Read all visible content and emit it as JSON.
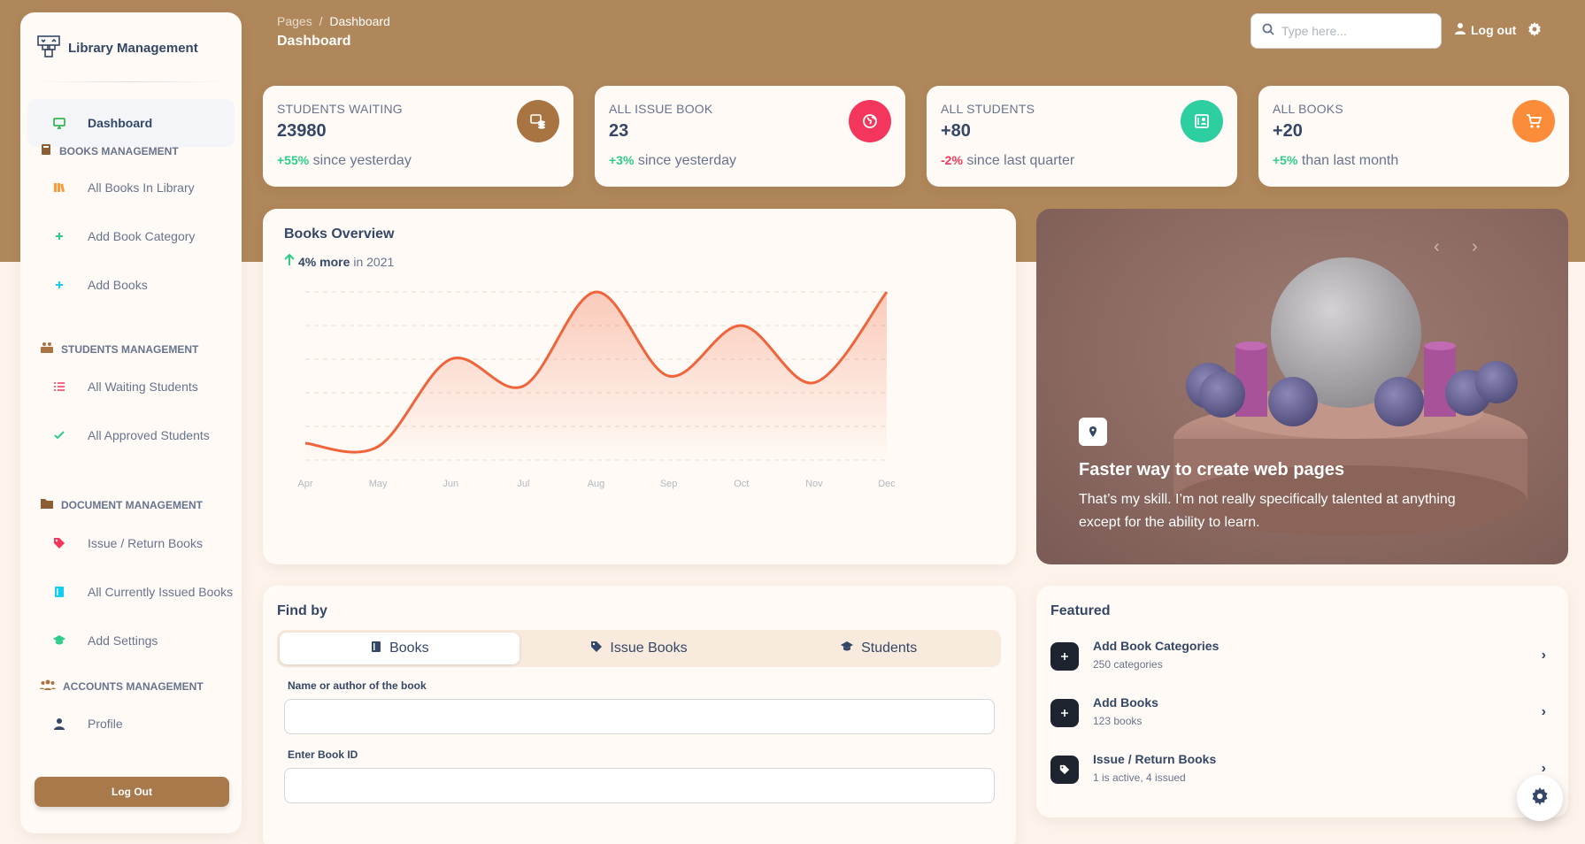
{
  "brand": {
    "name": "Library Management",
    "icon": "library-icon"
  },
  "sidebar": {
    "dashboard": {
      "label": "Dashboard",
      "icon": "monitor-icon"
    },
    "sections": [
      {
        "title": "Books Management",
        "icon": "book-icon",
        "items": [
          {
            "label": "All Books In Library",
            "icon": "books-icon"
          },
          {
            "label": "Add Book Category",
            "icon": "plus-icon"
          },
          {
            "label": "Add Books",
            "icon": "plus-icon"
          }
        ]
      },
      {
        "title": "Students Management",
        "icon": "students-icon",
        "items": [
          {
            "label": "All Waiting Students",
            "icon": "list-icon"
          },
          {
            "label": "All Approved Students",
            "icon": "check-icon"
          }
        ]
      },
      {
        "title": "Document Management",
        "icon": "folder-icon",
        "items": [
          {
            "label": "Issue / Return Books",
            "icon": "tag-icon"
          },
          {
            "label": "All Currently Issued Books",
            "icon": "book-open-icon"
          },
          {
            "label": "Add Settings",
            "icon": "graduation-cap-icon"
          }
        ]
      },
      {
        "title": "Accounts Management",
        "icon": "users-icon",
        "items": [
          {
            "label": "Profile",
            "icon": "user-icon"
          }
        ]
      }
    ],
    "logout_label": "Log Out"
  },
  "header": {
    "breadcrumb_parent": "Pages",
    "breadcrumb_separator": "/",
    "breadcrumb_current": "Dashboard",
    "title": "Dashboard",
    "search_placeholder": "Type here...",
    "logout_label": "Log out"
  },
  "stats": [
    {
      "title": "Students Waiting",
      "value": "23980",
      "pct": "+55%",
      "pct_color": "#2dce89",
      "foot": "since yesterday",
      "icon": "coins-icon",
      "icon_bg": "#a87442"
    },
    {
      "title": "All Issue Book",
      "value": "23",
      "pct": "+3%",
      "pct_color": "#2dce89",
      "foot": "since yesterday",
      "icon": "globe-icon",
      "icon_bg": "#f5365c"
    },
    {
      "title": "All Students",
      "value": "+80",
      "pct": "-2%",
      "pct_color": "#f5365c",
      "foot": "since last quarter",
      "icon": "id-card-icon",
      "icon_bg": "#2dcea0"
    },
    {
      "title": "All Books",
      "value": "+20",
      "pct": "+5%",
      "pct_color": "#2dce89",
      "foot": "than last month",
      "icon": "cart-icon",
      "icon_bg": "#fb8c3a"
    }
  ],
  "chart": {
    "title": "Books Overview",
    "sub_bold": "4% more",
    "sub_rest": "in 2021"
  },
  "chart_data": {
    "type": "line",
    "categories": [
      "Apr",
      "May",
      "Jun",
      "Jul",
      "Aug",
      "Sep",
      "Oct",
      "Nov",
      "Dec"
    ],
    "series": [
      {
        "values": [
          50,
          40,
          300,
          220,
          500,
          250,
          400,
          230,
          500
        ]
      }
    ],
    "ylim": [
      0,
      500
    ],
    "grid": true,
    "color": "#f0643c"
  },
  "hero": {
    "title": "Faster way to create web pages",
    "body": "That’s my skill. I’m not really specifically talented at anything except for the ability to learn.",
    "icon": "pin-icon"
  },
  "find": {
    "title": "Find by",
    "tabs": [
      {
        "label": "Books",
        "icon": "book-icon"
      },
      {
        "label": "Issue Books",
        "icon": "tag-icon"
      },
      {
        "label": "Students",
        "icon": "graduation-cap-icon"
      }
    ],
    "field1_label": "Name or author of the book",
    "field1_value": "",
    "field2_label": "Enter Book ID",
    "field2_value": ""
  },
  "featured": {
    "title": "Featured",
    "items": [
      {
        "name": "Add Book Categories",
        "desc": "250 categories",
        "icon": "plus-icon"
      },
      {
        "name": "Add Books",
        "desc": "123 books",
        "icon": "plus-icon"
      },
      {
        "name": "Issue / Return Books",
        "desc": "1 is active, 4 issued",
        "icon": "tag-icon"
      }
    ]
  }
}
